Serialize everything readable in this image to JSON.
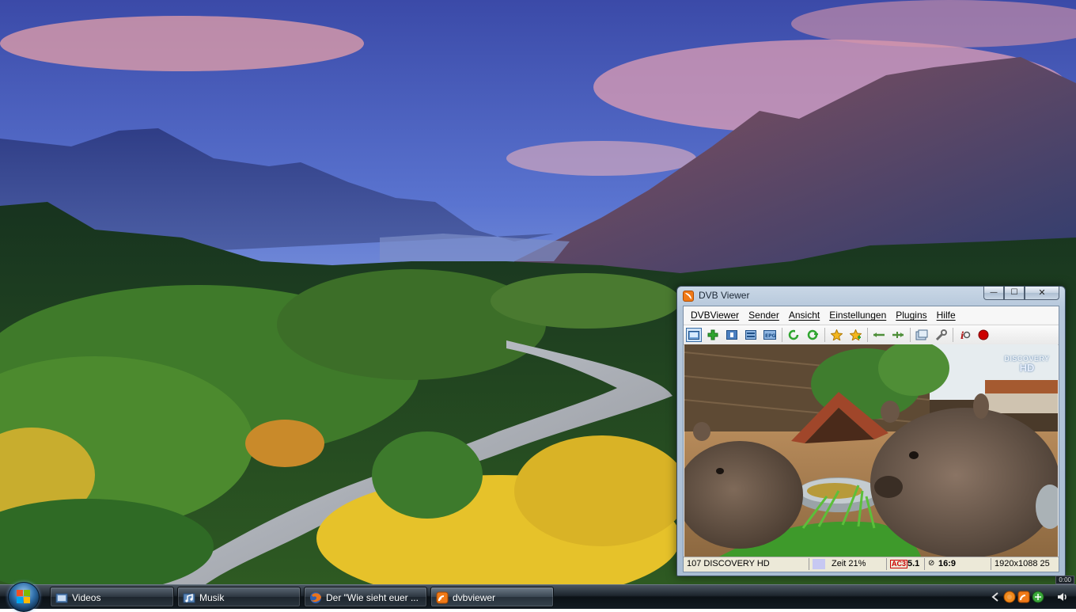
{
  "window": {
    "title": "DVB Viewer",
    "caption_buttons": {
      "minimize": "—",
      "maximize": "☐",
      "close": "✕"
    },
    "menu": [
      "DVBViewer",
      "Sender",
      "Ansicht",
      "Einstellungen",
      "Plugins",
      "Hilfe"
    ],
    "toolbar_icons": [
      "fullscreen-icon",
      "add-icon",
      "teletext-icon",
      "osd-icon",
      "epg-icon",
      "channel-back-icon",
      "channel-forward-icon",
      "favorite-icon",
      "favorite-add-icon",
      "volume-down-icon",
      "volume-up-icon",
      "snapshot-icon",
      "settings-wrench-icon",
      "info-icon",
      "record-icon"
    ],
    "epg_label": "EPG",
    "video": {
      "channel_logo": "DISCOVERY",
      "channel_logo_sub": "HD"
    },
    "status": {
      "channel": "107 DISCOVERY HD",
      "time": "Zeit 21%",
      "ac_badge": "AC3",
      "audio": "5.1",
      "aspect": "16:9",
      "resolution": "1920x1088 25"
    }
  },
  "taskbar": {
    "tasks": [
      {
        "label": "Videos",
        "icon": "videos-folder-icon"
      },
      {
        "label": "Musik",
        "icon": "music-folder-icon"
      },
      {
        "label": "Der \"Wie sieht euer ...",
        "icon": "firefox-icon"
      },
      {
        "label": "dvbviewer",
        "icon": "dvbviewer-icon"
      }
    ],
    "clock": "0:00"
  },
  "colors": {
    "accent_orange": "#f07a18",
    "record_red": "#cc0000",
    "taskbar_dark": "#131b22"
  }
}
